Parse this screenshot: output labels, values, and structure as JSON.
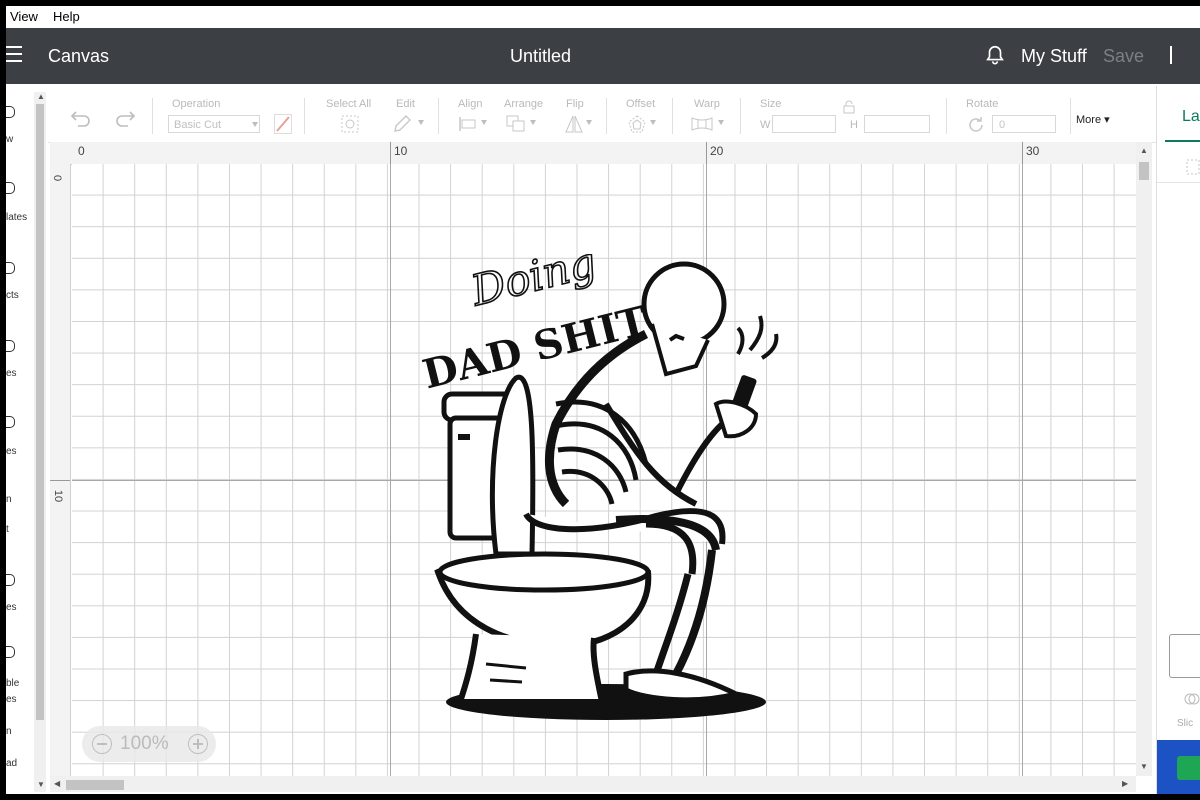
{
  "menu": {
    "view": "View",
    "help": "Help"
  },
  "header": {
    "app_title": "Canvas",
    "doc_title": "Untitled",
    "my_stuff": "My Stuff",
    "save": "Save"
  },
  "left_rail": {
    "items": [
      "w",
      "lates",
      "cts",
      "es",
      "es",
      "n",
      "t",
      "es",
      "ble\nes",
      "n",
      "ad"
    ]
  },
  "toolbar": {
    "operation_label": "Operation",
    "operation_value": "Basic Cut",
    "select_all_label": "Select All",
    "edit_label": "Edit",
    "align_label": "Align",
    "arrange_label": "Arrange",
    "flip_label": "Flip",
    "offset_label": "Offset",
    "warp_label": "Warp",
    "size_label": "Size",
    "w_label": "W",
    "h_label": "H",
    "rotate_label": "Rotate",
    "rotate_value": "0",
    "more_label": "More"
  },
  "right_panel": {
    "tab_label": "La",
    "slice_label": "Slic"
  },
  "rulers": {
    "top": [
      "0",
      "10",
      "20",
      "30"
    ],
    "left": [
      "0",
      "10"
    ]
  },
  "zoom": {
    "level": "100%"
  },
  "artwork": {
    "script_word": "Doing",
    "headline": "DAD SHIT"
  },
  "colors": {
    "appbar": "#3c4044",
    "accent": "#0d7a5f",
    "blue": "#1d52c5",
    "green": "#1fa655"
  }
}
